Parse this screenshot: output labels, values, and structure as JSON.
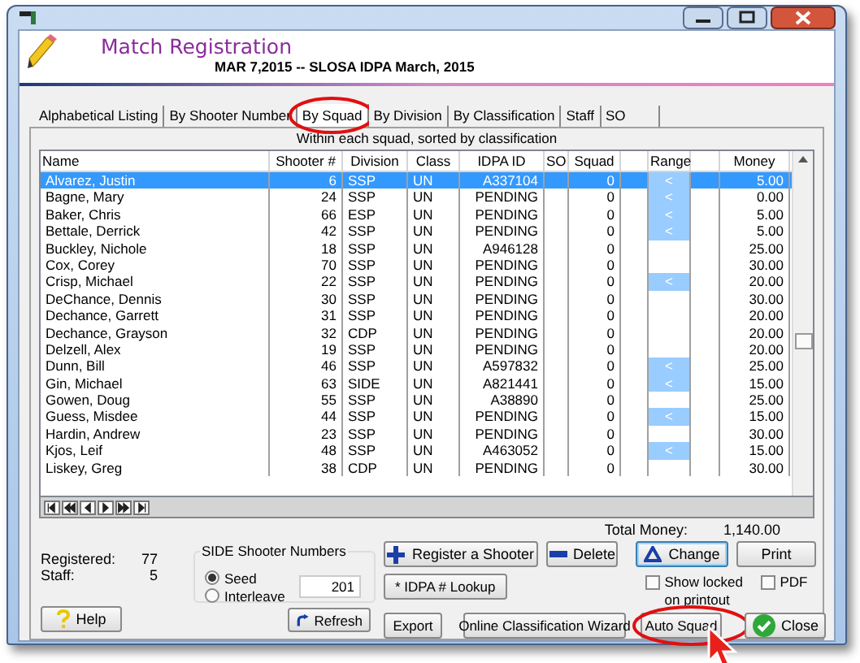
{
  "header": {
    "title": "Match Registration",
    "subtitle": "MAR  7,2015 -- SLOSA IDPA March, 2015"
  },
  "tabs": [
    {
      "label": "Alphabetical Listing",
      "selected": false,
      "circled": false
    },
    {
      "label": "By Shooter Number",
      "selected": false,
      "circled": false
    },
    {
      "label": "By Squad",
      "selected": true,
      "circled": true
    },
    {
      "label": "By Division",
      "selected": false,
      "circled": false
    },
    {
      "label": "By Classification",
      "selected": false,
      "circled": false
    },
    {
      "label": "Staff",
      "selected": false,
      "circled": false
    },
    {
      "label": "SO",
      "selected": false,
      "circled": false
    }
  ],
  "list": {
    "caption": "Within each squad, sorted by classification",
    "columns": [
      "Name",
      "Shooter #",
      "Division",
      "Class",
      "IDPA ID",
      "SO",
      "Squad",
      "Range",
      "Money"
    ],
    "rows": [
      {
        "name": "Alvarez, Justin",
        "shooter": "6",
        "division": "SSP",
        "class": "UN",
        "idpa_id": "A337104",
        "squad": "0",
        "range": "<",
        "money": "5.00",
        "selected": true
      },
      {
        "name": "Bagne, Mary",
        "shooter": "24",
        "division": "SSP",
        "class": "UN",
        "idpa_id": "PENDING",
        "squad": "0",
        "range": "<",
        "money": "0.00",
        "selected": false
      },
      {
        "name": "Baker, Chris",
        "shooter": "66",
        "division": "ESP",
        "class": "UN",
        "idpa_id": "PENDING",
        "squad": "0",
        "range": "<",
        "money": "5.00",
        "selected": false
      },
      {
        "name": "Bettale, Derrick",
        "shooter": "42",
        "division": "SSP",
        "class": "UN",
        "idpa_id": "PENDING",
        "squad": "0",
        "range": "<",
        "money": "5.00",
        "selected": false
      },
      {
        "name": "Buckley, Nichole",
        "shooter": "18",
        "division": "SSP",
        "class": "UN",
        "idpa_id": "A946128",
        "squad": "0",
        "money": "25.00",
        "selected": false
      },
      {
        "name": "Cox, Corey",
        "shooter": "70",
        "division": "SSP",
        "class": "UN",
        "idpa_id": "PENDING",
        "squad": "0",
        "money": "30.00",
        "selected": false
      },
      {
        "name": "Crisp, Michael",
        "shooter": "22",
        "division": "SSP",
        "class": "UN",
        "idpa_id": "PENDING",
        "squad": "0",
        "range": "<",
        "money": "20.00",
        "selected": false
      },
      {
        "name": "DeChance, Dennis",
        "shooter": "30",
        "division": "SSP",
        "class": "UN",
        "idpa_id": "PENDING",
        "squad": "0",
        "money": "30.00",
        "selected": false
      },
      {
        "name": "Dechance, Garrett",
        "shooter": "31",
        "division": "SSP",
        "class": "UN",
        "idpa_id": "PENDING",
        "squad": "0",
        "money": "20.00",
        "selected": false
      },
      {
        "name": "Dechance, Grayson",
        "shooter": "32",
        "division": "CDP",
        "class": "UN",
        "idpa_id": "PENDING",
        "squad": "0",
        "money": "20.00",
        "selected": false
      },
      {
        "name": "Delzell, Alex",
        "shooter": "19",
        "division": "SSP",
        "class": "UN",
        "idpa_id": "PENDING",
        "squad": "0",
        "money": "20.00",
        "selected": false
      },
      {
        "name": "Dunn, Bill",
        "shooter": "46",
        "division": "SSP",
        "class": "UN",
        "idpa_id": "A597832",
        "squad": "0",
        "range": "<",
        "money": "25.00",
        "selected": false
      },
      {
        "name": "Gin, Michael",
        "shooter": "63",
        "division": "SIDE",
        "class": "UN",
        "idpa_id": "A821441",
        "squad": "0",
        "range": "<",
        "money": "15.00",
        "selected": false
      },
      {
        "name": "Gowen, Doug",
        "shooter": "55",
        "division": "SSP",
        "class": "UN",
        "idpa_id": "A38890",
        "squad": "0",
        "money": "25.00",
        "selected": false
      },
      {
        "name": "Guess, Misdee",
        "shooter": "44",
        "division": "SSP",
        "class": "UN",
        "idpa_id": "PENDING",
        "squad": "0",
        "range": "<",
        "money": "15.00",
        "selected": false
      },
      {
        "name": "Hardin, Andrew",
        "shooter": "23",
        "division": "SSP",
        "class": "UN",
        "idpa_id": "PENDING",
        "squad": "0",
        "money": "30.00",
        "selected": false
      },
      {
        "name": "Kjos, Leif",
        "shooter": "48",
        "division": "SSP",
        "class": "UN",
        "idpa_id": "A463052",
        "squad": "0",
        "range": "<",
        "money": "15.00",
        "selected": false
      },
      {
        "name": "Liskey, Greg",
        "shooter": "38",
        "division": "CDP",
        "class": "UN",
        "idpa_id": "PENDING",
        "squad": "0",
        "money": "30.00",
        "selected": false
      }
    ]
  },
  "summary": {
    "total_label": "Total Money:",
    "total": "1,140.00",
    "registered_label": "Registered:",
    "registered": "77",
    "staff_label": "Staff:",
    "staff": "5"
  },
  "side_numbers": {
    "title": "SIDE Shooter Numbers",
    "options": [
      {
        "label": "Seed",
        "selected": true
      },
      {
        "label": "Interleave",
        "selected": false
      }
    ],
    "value": "201"
  },
  "buttons": [
    {
      "label": "Register a Shooter",
      "kind": "plus",
      "circled": false
    },
    {
      "label": "Delete",
      "kind": "minus",
      "circled": false
    },
    {
      "label": "Change",
      "kind": "triangle",
      "circled": false
    },
    {
      "label": "Print",
      "kind": "plain",
      "circled": false
    },
    {
      "label": "* IDPA # Lookup",
      "kind": "plain",
      "circled": false
    },
    {
      "label": "Export",
      "kind": "plain",
      "circled": false
    },
    {
      "label": "Online Classification Wizard",
      "kind": "plain",
      "circled": false
    },
    {
      "label": "Auto Squad",
      "kind": "plain",
      "circled": true
    },
    {
      "label": "Close",
      "kind": "check",
      "circled": false
    }
  ],
  "checkboxes": [
    {
      "label": "Show locked on printout",
      "checked": false
    },
    {
      "label": "PDF",
      "checked": false
    }
  ],
  "help_button": {
    "label": "Help"
  },
  "refresh_button": {
    "label": "Refresh"
  }
}
